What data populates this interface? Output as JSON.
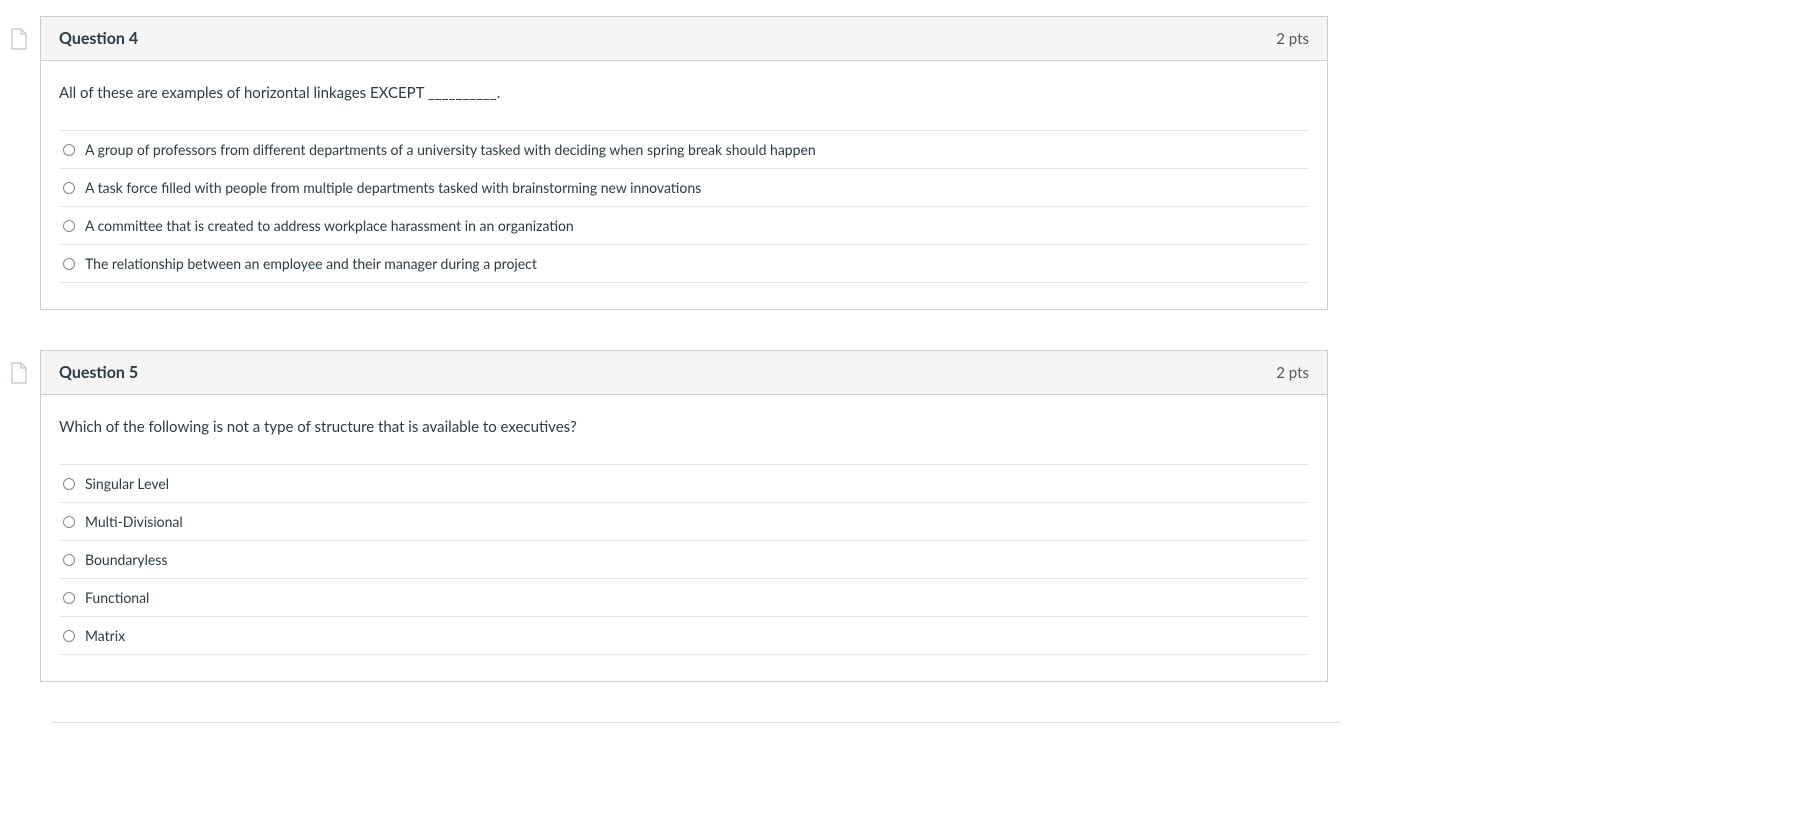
{
  "questions": [
    {
      "title": "Question 4",
      "points": "2 pts",
      "text": "All of these are examples of horizontal linkages EXCEPT __________.",
      "answers": [
        "A group of professors from different departments of a university tasked with deciding when spring break should happen",
        "A task force filled with people from multiple departments tasked with brainstorming new innovations",
        "A committee that is created to address workplace harassment in an organization",
        "The relationship between an employee and their manager during a project"
      ]
    },
    {
      "title": "Question 5",
      "points": "2 pts",
      "text": "Which of the following is not a type of structure that is available to executives?",
      "answers": [
        "Singular Level",
        "Multi-Divisional",
        "Boundaryless",
        "Functional",
        "Matrix"
      ]
    }
  ]
}
